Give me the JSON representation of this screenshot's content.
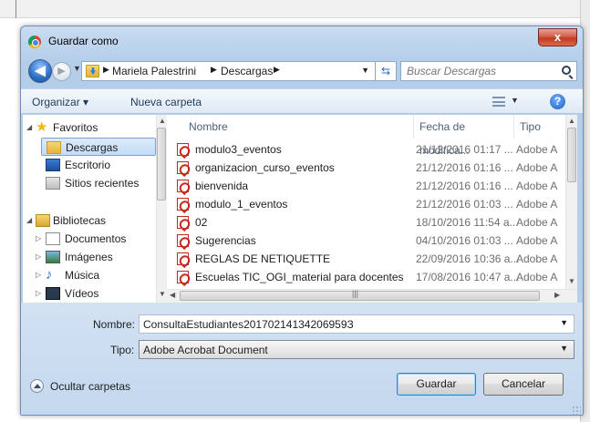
{
  "window": {
    "title": "Guardar como",
    "close_label": "x"
  },
  "address": {
    "crumbs": [
      "Mariela Palestrini",
      "Descargas"
    ]
  },
  "search": {
    "placeholder": "Buscar Descargas"
  },
  "toolbar": {
    "organize_label": "Organizar ▾",
    "new_folder_label": "Nueva carpeta"
  },
  "sidebar": {
    "items": [
      {
        "label": "Favoritos",
        "icon": "star-icon",
        "selected": false
      },
      {
        "label": "Descargas",
        "icon": "downloads-folder-icon",
        "selected": true
      },
      {
        "label": "Escritorio",
        "icon": "desktop-icon",
        "selected": false
      },
      {
        "label": "Sitios recientes",
        "icon": "recent-places-icon",
        "selected": false
      },
      {
        "label": "Bibliotecas",
        "icon": "libraries-icon",
        "selected": false
      },
      {
        "label": "Documentos",
        "icon": "documents-icon",
        "selected": false
      },
      {
        "label": "Imágenes",
        "icon": "pictures-icon",
        "selected": false
      },
      {
        "label": "Música",
        "icon": "music-icon",
        "selected": false
      },
      {
        "label": "Vídeos",
        "icon": "videos-icon",
        "selected": false
      }
    ]
  },
  "files": {
    "columns": [
      "Nombre",
      "Fecha de modifica...",
      "Tipo"
    ],
    "rows": [
      {
        "name": "modulo3_eventos",
        "date": "21/12/2016 01:17 ...",
        "type": "Adobe A"
      },
      {
        "name": "organizacion_curso_eventos",
        "date": "21/12/2016 01:16 ...",
        "type": "Adobe A"
      },
      {
        "name": "bienvenida",
        "date": "21/12/2016 01:16 ...",
        "type": "Adobe A"
      },
      {
        "name": "modulo_1_eventos",
        "date": "21/12/2016 01:03 ...",
        "type": "Adobe A"
      },
      {
        "name": "02",
        "date": "18/10/2016 11:54 a...",
        "type": "Adobe A"
      },
      {
        "name": "Sugerencias",
        "date": "04/10/2016 01:03 ...",
        "type": "Adobe A"
      },
      {
        "name": "REGLAS DE NETIQUETTE",
        "date": "22/09/2016 10:36 a...",
        "type": "Adobe A"
      },
      {
        "name": "Escuelas TIC_OGI_material para docentes",
        "date": "17/08/2016 10:47 a...",
        "type": "Adobe A"
      }
    ]
  },
  "form": {
    "name_label": "Nombre:",
    "name_value": "ConsultaEstudiantes20170214134206959З",
    "type_label": "Tipo:",
    "type_value": "Adobe Acrobat Document"
  },
  "footer": {
    "hide_folders_label": "Ocultar carpetas",
    "save_label": "Guardar",
    "cancel_label": "Cancelar"
  }
}
